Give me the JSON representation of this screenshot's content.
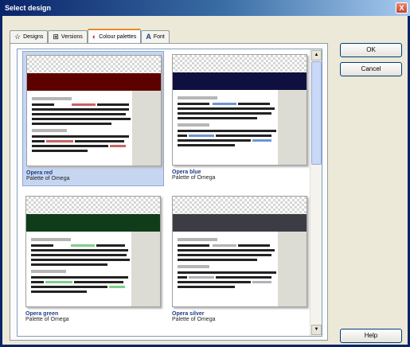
{
  "window": {
    "title": "Select design",
    "close_glyph": "X"
  },
  "tabs": [
    {
      "label": "Designs",
      "icon": "star-icon",
      "glyph": "☆"
    },
    {
      "label": "Versions",
      "icon": "grid-icon",
      "glyph": "⊞"
    },
    {
      "label": "Colour palettes",
      "icon": "palette-icon",
      "glyph": "◐",
      "active": true
    },
    {
      "label": "Font",
      "icon": "font-icon",
      "glyph": "A"
    }
  ],
  "buttons": {
    "ok": "OK",
    "cancel": "Cancel",
    "help": "Help"
  },
  "palettes": [
    {
      "name": "Opera red",
      "subtitle": "Palette of Omega",
      "band_color": "#5c0000",
      "accent_color": "#c86464",
      "selected": true
    },
    {
      "name": "Opera blue",
      "subtitle": "Palette of Omega",
      "band_color": "#101040",
      "accent_color": "#6e94d0",
      "selected": false
    },
    {
      "name": "Opera green",
      "subtitle": "Palette of Omega",
      "band_color": "#0f3d1a",
      "accent_color": "#7ecf88",
      "selected": false
    },
    {
      "name": "Opera silver",
      "subtitle": "Palette of Omega",
      "band_color": "#3c3c44",
      "accent_color": "#b0b0b8",
      "selected": false
    }
  ],
  "colors": {
    "title_gradient_start": "#0a246a",
    "selection": "#c6d6f0"
  }
}
